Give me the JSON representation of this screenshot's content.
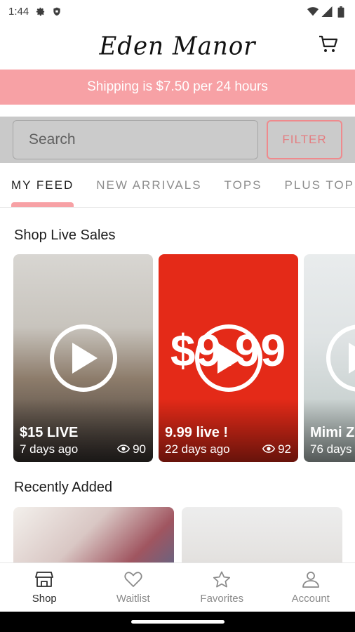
{
  "status_bar": {
    "time": "1:44",
    "icons": [
      "settings-icon",
      "shield-icon",
      "wifi-icon",
      "signal-icon",
      "battery-icon"
    ]
  },
  "header": {
    "logo_text": "Eden Manor",
    "cart_icon": "cart-icon"
  },
  "promo_banner": {
    "text": "Shipping is $7.50 per 24 hours",
    "color": "#f7a1a5"
  },
  "search": {
    "placeholder": "Search",
    "filter_label": "FILTER"
  },
  "tabs": [
    {
      "label": "MY FEED",
      "active": true
    },
    {
      "label": "NEW ARRIVALS",
      "active": false
    },
    {
      "label": "TOPS",
      "active": false
    },
    {
      "label": "PLUS TOPS",
      "active": false
    }
  ],
  "live_section": {
    "title": "Shop Live Sales",
    "cards": [
      {
        "title": "$15 LIVE",
        "time": "7 days ago",
        "views": "90"
      },
      {
        "title": "9.99 live !",
        "time": "22 days ago",
        "views": "92",
        "graphic_text": "$9.99"
      },
      {
        "title": "Mimi Z",
        "time": "76 days",
        "views": ""
      }
    ]
  },
  "recent_section": {
    "title": "Recently Added"
  },
  "bottom_nav": [
    {
      "label": "Shop",
      "icon": "shop-icon",
      "active": true
    },
    {
      "label": "Waitlist",
      "icon": "heart-icon",
      "active": false
    },
    {
      "label": "Favorites",
      "icon": "star-icon",
      "active": false
    },
    {
      "label": "Account",
      "icon": "account-icon",
      "active": false
    }
  ],
  "colors": {
    "accent": "#f7a1a5",
    "filter_text": "#e47d80",
    "search_bg": "#c9c9c9"
  }
}
